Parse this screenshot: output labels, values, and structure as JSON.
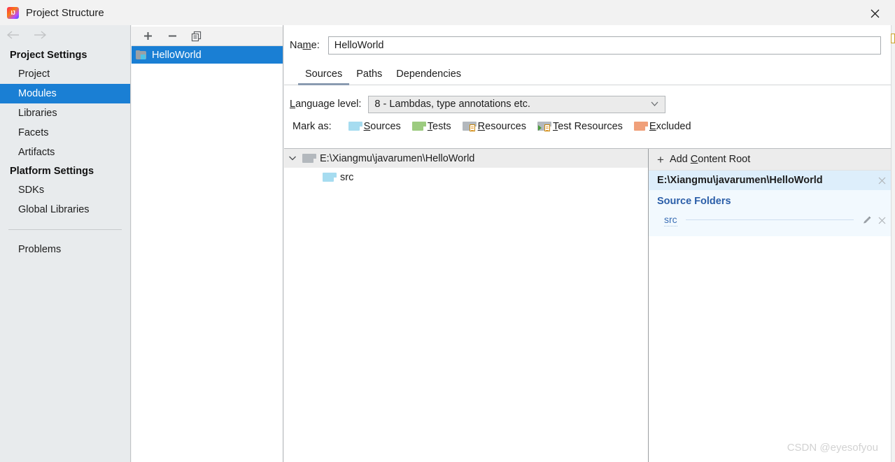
{
  "window": {
    "title": "Project Structure",
    "app_icon": "intellij-idea-logo",
    "close_icon": "close-icon"
  },
  "sidebar": {
    "back_icon": "arrow-left-icon",
    "forward_icon": "arrow-right-icon",
    "groups": [
      {
        "label": "Project Settings",
        "items": [
          {
            "label": "Project",
            "selected": false
          },
          {
            "label": "Modules",
            "selected": true
          },
          {
            "label": "Libraries",
            "selected": false
          },
          {
            "label": "Facets",
            "selected": false
          },
          {
            "label": "Artifacts",
            "selected": false
          }
        ]
      },
      {
        "label": "Platform Settings",
        "items": [
          {
            "label": "SDKs",
            "selected": false
          },
          {
            "label": "Global Libraries",
            "selected": false
          }
        ]
      }
    ],
    "problems_label": "Problems"
  },
  "modules_panel": {
    "toolbar": {
      "add_label": "+",
      "remove_label": "−",
      "copy_icon": "copy-icon"
    },
    "items": [
      {
        "label": "HelloWorld",
        "icon": "module-folder-icon",
        "selected": true
      }
    ]
  },
  "module_editor": {
    "name_label_pre": "Na",
    "name_label_mnemonic": "m",
    "name_label_post": "e:",
    "name_value": "HelloWorld",
    "name_placeholder": "",
    "tabs": [
      {
        "label": "Sources",
        "active": true
      },
      {
        "label": "Paths",
        "active": false
      },
      {
        "label": "Dependencies",
        "active": false
      }
    ],
    "language_level": {
      "label_pre": "",
      "label_mnemonic": "L",
      "label_post": "anguage level:",
      "value": "8 - Lambdas, type annotations etc.",
      "chevron_icon": "chevron-down-icon"
    },
    "mark_as": {
      "label": "Mark as:",
      "options": [
        {
          "pre": "",
          "mnemonic": "S",
          "post": "ources",
          "color": "blue",
          "icon": "sources-folder-icon"
        },
        {
          "pre": "",
          "mnemonic": "T",
          "post": "ests",
          "color": "green",
          "icon": "tests-folder-icon"
        },
        {
          "pre": "",
          "mnemonic": "R",
          "post": "esources",
          "color": "gray",
          "icon": "resources-folder-icon"
        },
        {
          "pre": "",
          "mnemonic": "T",
          "post": "est Resources",
          "color": "gray-green",
          "icon": "test-resources-folder-icon"
        },
        {
          "pre": "",
          "mnemonic": "E",
          "post": "xcluded",
          "color": "orange",
          "icon": "excluded-folder-icon"
        }
      ]
    }
  },
  "content_tree": {
    "root": {
      "label": "E:\\Xiangmu\\javarumen\\HelloWorld",
      "icon": "folder-icon",
      "expanded": true,
      "chevron_icon": "chevron-down-icon"
    },
    "children": [
      {
        "label": "src",
        "icon": "sources-folder-icon"
      }
    ]
  },
  "content_detail": {
    "add_root_pre": "Add ",
    "add_root_mnemonic": "C",
    "add_root_post": "ontent Root",
    "add_icon": "plus-icon",
    "root_path": "E:\\Xiangmu\\javarumen\\HelloWorld",
    "root_remove_icon": "close-icon",
    "source_folders_title": "Source Folders",
    "source_folders": [
      {
        "name": "src",
        "edit_icon": "pencil-icon",
        "remove_icon": "close-icon"
      }
    ]
  },
  "watermark": "CSDN @eyesofyou",
  "colors": {
    "accent_selection": "#1a7fd4",
    "sidebar_bg": "#e8ebed",
    "panel_bg": "#f2f2f2",
    "link_blue": "#2b5ea8",
    "highlight_row": "#ddeefb"
  }
}
